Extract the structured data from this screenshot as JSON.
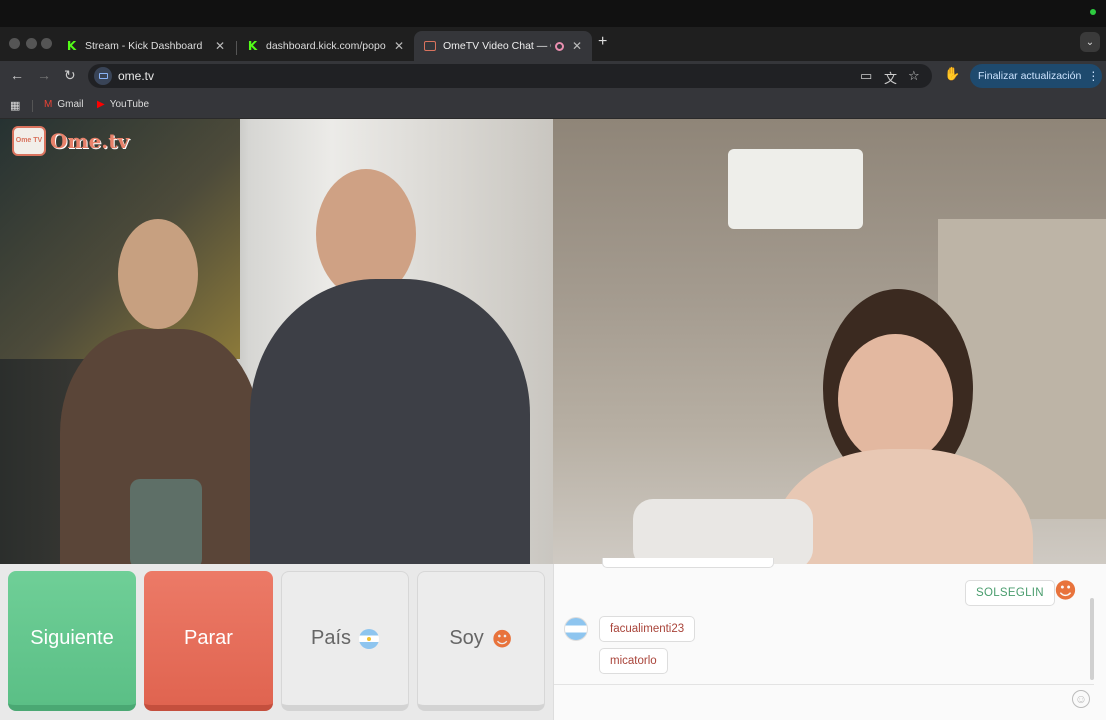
{
  "browser": {
    "tabs": [
      {
        "title": "Stream - Kick Dashboard",
        "favicon": "kick-icon"
      },
      {
        "title": "dashboard.kick.com/popout/...",
        "favicon": "kick-icon"
      },
      {
        "title": "OmeTV Video Chat — Ome",
        "favicon": "ometv-icon",
        "active": true
      }
    ],
    "url": "ome.tv",
    "update_button": "Finalizar actualización",
    "bookmarks": [
      {
        "label": "Gmail",
        "icon": "gmail-icon"
      },
      {
        "label": "YouTube",
        "icon": "youtube-icon"
      }
    ]
  },
  "site": {
    "logo_badge": "Ome TV",
    "logo_word": "Ome.tv"
  },
  "controls": {
    "next": "Siguiente",
    "stop": "Parar",
    "country": "País",
    "gender": "Soy"
  },
  "chat": {
    "messages": [
      {
        "from": "me",
        "text": "SOLSEGLIN"
      },
      {
        "from": "them",
        "text": "facualimenti23"
      },
      {
        "from": "them",
        "text": "micatorlo"
      }
    ]
  },
  "colors": {
    "next": "#6fcf97",
    "stop": "#ec7a67",
    "accent": "#e8826b"
  }
}
